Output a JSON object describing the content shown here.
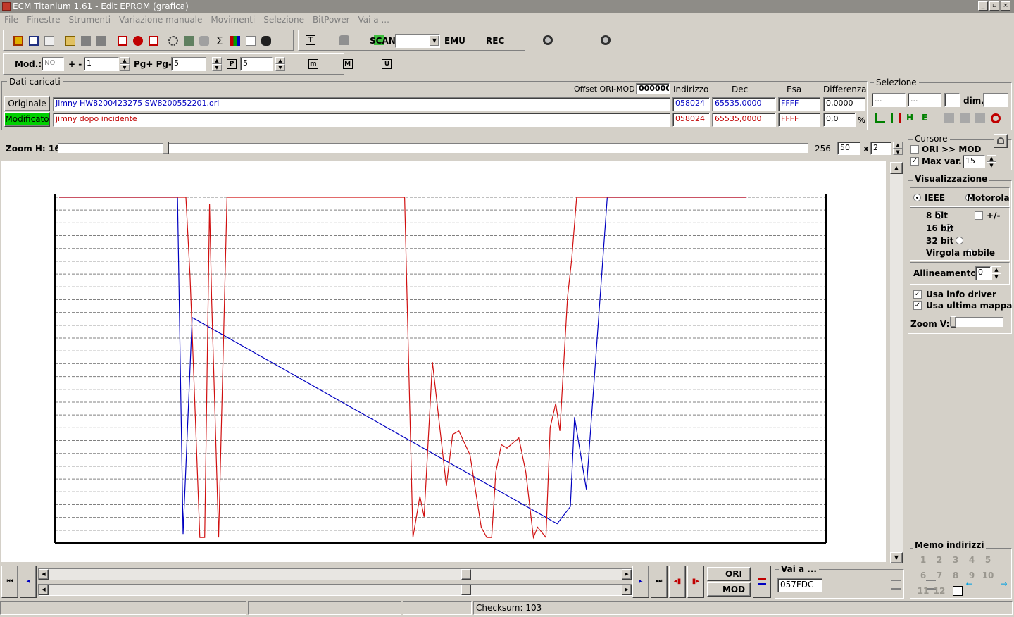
{
  "window": {
    "title": "ECM Titanium 1.61 - Edit EPROM (grafica)",
    "min": "_",
    "restore": "▫",
    "close": "×"
  },
  "menu": [
    "File",
    "Finestre",
    "Strumenti",
    "Variazione manuale",
    "Movimenti",
    "Selezione",
    "BitPower",
    "Vai a ..."
  ],
  "toolbar": {
    "scan_label": "SCAN",
    "emu_label": "EMU",
    "rec_label": "REC",
    "scan_value": ""
  },
  "toolbar2": {
    "mod_label": "Mod.:",
    "mod_value": "NO",
    "plusminus_label": "+ -",
    "plusminus_value": "1",
    "pg_label": "Pg+ Pg-",
    "pg_value": "5",
    "p_value": "5"
  },
  "dati": {
    "title": "Dati caricati",
    "offset_label": "Offset ORI-MOD",
    "offset_value": "000000",
    "col_indirizzo": "Indirizzo",
    "col_dec": "Dec",
    "col_esa": "Esa",
    "col_diff": "Differenza",
    "originale_button": "Originale",
    "modificato_button": "Modificato",
    "ori_file": "Jimny HW8200423275 SW8200552201.ori",
    "mod_file": "jimny dopo incidente",
    "ori_addr": "058024",
    "ori_dec": "65535,0000",
    "ori_esa": "FFFF",
    "ori_diff": "0,0000",
    "mod_addr": "058024",
    "mod_dec": "65535,0000",
    "mod_esa": "FFFF",
    "mod_diff": "0,0",
    "percent": "%"
  },
  "selezione": {
    "title": "Selezione",
    "field1": "...",
    "field2": "...",
    "field3": "",
    "dim_label": "dim.",
    "dim_value": ""
  },
  "zoom": {
    "label": "Zoom H: 16",
    "max": "256",
    "value": "50",
    "x_label": "x",
    "mult": "2",
    "slider_fraction": 0.14
  },
  "cursore": {
    "title": "Cursore",
    "ori_mod_label": "ORI >> MOD",
    "ori_mod_checked": false,
    "maxvar_label": "Max var.",
    "maxvar_checked": true,
    "maxvar_value": "15"
  },
  "visualizzazione": {
    "title": "Visualizzazione",
    "ieee": "IEEE",
    "motorola": "Motorola",
    "bit8": "8 bit",
    "sign": "+/-",
    "bit16": "16 bit",
    "bit32": "32 bit",
    "virgola": "Virgola mobile",
    "allineamento_label": "Allineamento:",
    "allineamento_value": "0",
    "usa_info": "Usa info driver",
    "usa_ultima": "Usa ultima mappa",
    "zoomv_label": "Zoom V:"
  },
  "nav": {
    "ori_label": "ORI",
    "mod_label": "MOD",
    "vai_a_label": "Vai a ...",
    "vai_a_value": "057FDC"
  },
  "memo": {
    "title": "Memo indirizzi",
    "numbers": [
      "1",
      "2",
      "3",
      "4",
      "5",
      "6",
      "7",
      "8",
      "9",
      "10",
      "11",
      "12"
    ]
  },
  "status": {
    "checksum": "Checksum: 103"
  },
  "colors": {
    "ori": "#0000c0",
    "mod": "#d01010",
    "modificato_bg": "#00d000"
  },
  "chart_data": {
    "type": "line",
    "ylim": [
      0,
      1
    ],
    "grid": "horizontal dashed",
    "series": [
      {
        "key": "ori",
        "points": [
          [
            0,
            1
          ],
          [
            170,
            1
          ],
          [
            178,
            0.02
          ],
          [
            191,
            0.65
          ],
          [
            715,
            0.05
          ],
          [
            734,
            0.1
          ],
          [
            740,
            0.36
          ],
          [
            757,
            0.15
          ],
          [
            787,
            1
          ],
          [
            987,
            1
          ]
        ]
      },
      {
        "key": "mod",
        "points": [
          [
            0,
            1
          ],
          [
            182,
            1
          ],
          [
            188,
            0.77
          ],
          [
            202,
            0.01
          ],
          [
            209,
            0.01
          ],
          [
            216,
            0.98
          ],
          [
            219,
            0.7
          ],
          [
            229,
            0.01
          ],
          [
            241,
            1
          ],
          [
            496,
            1
          ],
          [
            508,
            0.01
          ],
          [
            518,
            0.13
          ],
          [
            524,
            0.07
          ],
          [
            536,
            0.52
          ],
          [
            556,
            0.16
          ],
          [
            565,
            0.31
          ],
          [
            574,
            0.32
          ],
          [
            590,
            0.25
          ],
          [
            606,
            0.04
          ],
          [
            614,
            0.01
          ],
          [
            621,
            0.01
          ],
          [
            627,
            0.2
          ],
          [
            635,
            0.28
          ],
          [
            643,
            0.27
          ],
          [
            660,
            0.3
          ],
          [
            670,
            0.2
          ],
          [
            681,
            0.01
          ],
          [
            687,
            0.04
          ],
          [
            699,
            0.01
          ],
          [
            705,
            0.33
          ],
          [
            713,
            0.4
          ],
          [
            719,
            0.32
          ],
          [
            730,
            0.71
          ],
          [
            736,
            0.82
          ],
          [
            743,
            1
          ],
          [
            987,
            1
          ]
        ]
      }
    ]
  }
}
